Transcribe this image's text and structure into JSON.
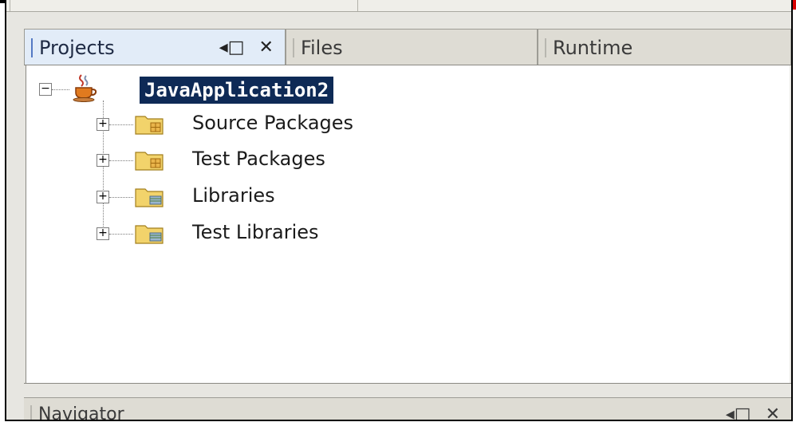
{
  "tabs": [
    {
      "label": "Projects",
      "active": true
    },
    {
      "label": "Files",
      "active": false
    },
    {
      "label": "Runtime",
      "active": false
    }
  ],
  "tab_controls": {
    "minimize_glyph": "◂□",
    "close_glyph": "✕"
  },
  "tree": {
    "root": {
      "label": "JavaApplication2",
      "icon": "coffee-cup-icon",
      "expander": "−"
    },
    "children": [
      {
        "label": "Source Packages",
        "icon": "package-folder-icon",
        "expander": "+"
      },
      {
        "label": "Test Packages",
        "icon": "package-folder-icon",
        "expander": "+"
      },
      {
        "label": "Libraries",
        "icon": "library-folder-icon",
        "expander": "+"
      },
      {
        "label": "Test Libraries",
        "icon": "library-folder-icon",
        "expander": "+"
      }
    ]
  },
  "navigator": {
    "label": "Navigator",
    "minimize_glyph": "◂□",
    "close_glyph": "✕"
  },
  "colors": {
    "selection_bg": "#0e2a56",
    "active_tab_bar": "#5479c4",
    "folder_yellow": "#f2d36b"
  }
}
